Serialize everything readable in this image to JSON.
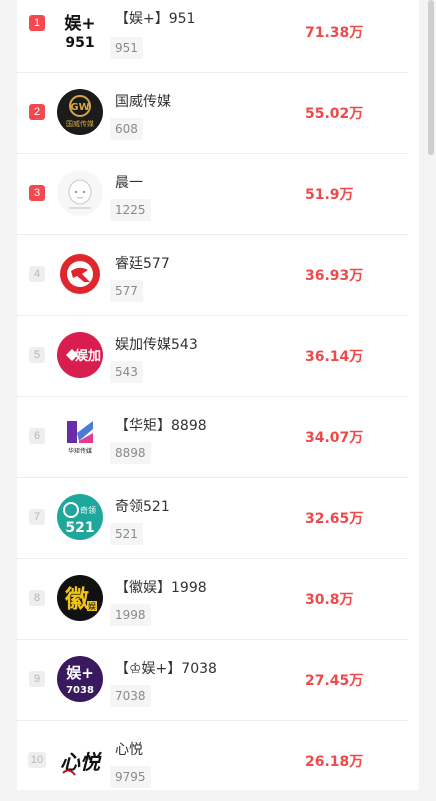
{
  "rows": [
    {
      "rank": "1",
      "name": "【娱+】951",
      "id": "951",
      "value": "71.38万",
      "avatar": "yujia-951-logo"
    },
    {
      "rank": "2",
      "name": "国威传媒",
      "id": "608",
      "value": "55.02万",
      "avatar": "guowei-media-logo"
    },
    {
      "rank": "3",
      "name": "晨一",
      "id": "1225",
      "value": "51.9万",
      "avatar": "chenyi-cartoon-logo"
    },
    {
      "rank": "4",
      "name": "睿廷577",
      "id": "577",
      "value": "36.93万",
      "avatar": "ruiting-logo"
    },
    {
      "rank": "5",
      "name": "娱加传媒543",
      "id": "543",
      "value": "36.14万",
      "avatar": "yujia-media-logo"
    },
    {
      "rank": "6",
      "name": "【华矩】8898",
      "id": "8898",
      "value": "34.07万",
      "avatar": "huaju-media-logo"
    },
    {
      "rank": "7",
      "name": "奇领521",
      "id": "521",
      "value": "32.65万",
      "avatar": "qiling-521-logo"
    },
    {
      "rank": "8",
      "name": "【徽娱】1998",
      "id": "1998",
      "value": "30.8万",
      "avatar": "huiyu-logo"
    },
    {
      "rank": "9",
      "name": "【♔娱+】7038",
      "id": "7038",
      "value": "27.45万",
      "avatar": "yujia-7038-logo"
    },
    {
      "rank": "10",
      "name": "心悦",
      "id": "9795",
      "value": "26.18万",
      "avatar": "xinyue-logo"
    }
  ],
  "logo_text": {
    "yujia_951_main": "娱+",
    "yujia_951_sub": "951",
    "guowei_gw": "GW",
    "guowei_cn": "国威传媒",
    "yujia_media_cn": "娱加",
    "huaju_cn": "华矩传媒",
    "qiling_cn": "奇领",
    "qiling_num": "521",
    "huiyu_cn": "徽",
    "huiyu_sub": "娱",
    "yujia_7038_main": "娱+",
    "yujia_7038_sub": "7038",
    "xinyue_cn": "心悦"
  }
}
